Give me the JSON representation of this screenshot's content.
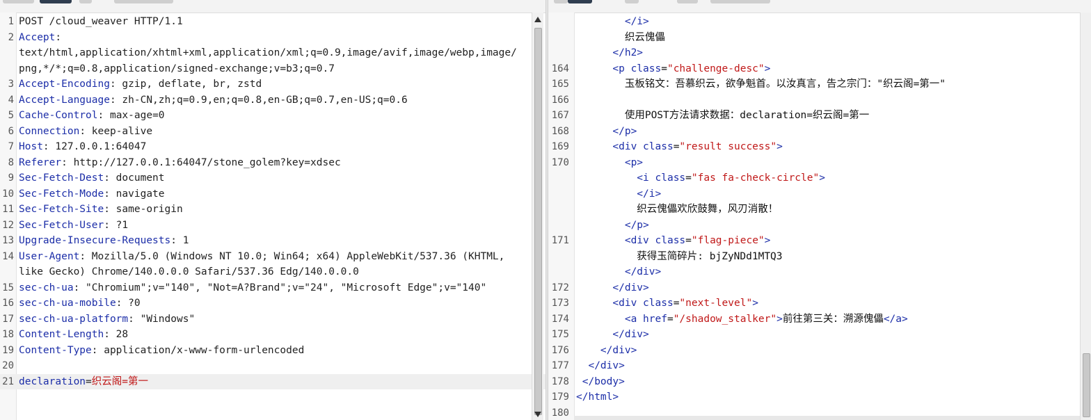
{
  "request": {
    "lines": [
      {
        "n": "1",
        "parts": [
          {
            "t": "POST /cloud_weaver HTTP/1.1",
            "c": "v"
          }
        ]
      },
      {
        "n": "2",
        "parts": [
          {
            "t": "Accept",
            "c": "k"
          },
          {
            "t": ":",
            "c": "v"
          }
        ]
      },
      {
        "n": "",
        "parts": [
          {
            "t": "text/html,application/xhtml+xml,application/xml;q=0.9,image/avif,image/webp,image/",
            "c": "v"
          }
        ]
      },
      {
        "n": "",
        "parts": [
          {
            "t": "png,*/*;q=0.8,application/signed-exchange;v=b3;q=0.7",
            "c": "v"
          }
        ]
      },
      {
        "n": "3",
        "parts": [
          {
            "t": "Accept-Encoding",
            "c": "k"
          },
          {
            "t": ": gzip, deflate, br, zstd",
            "c": "v"
          }
        ]
      },
      {
        "n": "4",
        "parts": [
          {
            "t": "Accept-Language",
            "c": "k"
          },
          {
            "t": ": zh-CN,zh;q=0.9,en;q=0.8,en-GB;q=0.7,en-US;q=0.6",
            "c": "v"
          }
        ]
      },
      {
        "n": "5",
        "parts": [
          {
            "t": "Cache-Control",
            "c": "k"
          },
          {
            "t": ": max-age=0",
            "c": "v"
          }
        ]
      },
      {
        "n": "6",
        "parts": [
          {
            "t": "Connection",
            "c": "k"
          },
          {
            "t": ": keep-alive",
            "c": "v"
          }
        ]
      },
      {
        "n": "7",
        "parts": [
          {
            "t": "Host",
            "c": "k"
          },
          {
            "t": ": 127.0.0.1:64047",
            "c": "v"
          }
        ]
      },
      {
        "n": "8",
        "parts": [
          {
            "t": "Referer",
            "c": "k"
          },
          {
            "t": ": http://127.0.0.1:64047/stone_golem?key=xdsec",
            "c": "v"
          }
        ]
      },
      {
        "n": "9",
        "parts": [
          {
            "t": "Sec-Fetch-Dest",
            "c": "k"
          },
          {
            "t": ": document",
            "c": "v"
          }
        ]
      },
      {
        "n": "10",
        "parts": [
          {
            "t": "Sec-Fetch-Mode",
            "c": "k"
          },
          {
            "t": ": navigate",
            "c": "v"
          }
        ]
      },
      {
        "n": "11",
        "parts": [
          {
            "t": "Sec-Fetch-Site",
            "c": "k"
          },
          {
            "t": ": same-origin",
            "c": "v"
          }
        ]
      },
      {
        "n": "12",
        "parts": [
          {
            "t": "Sec-Fetch-User",
            "c": "k"
          },
          {
            "t": ": ?1",
            "c": "v"
          }
        ]
      },
      {
        "n": "13",
        "parts": [
          {
            "t": "Upgrade-Insecure-Requests",
            "c": "k"
          },
          {
            "t": ": 1",
            "c": "v"
          }
        ]
      },
      {
        "n": "14",
        "parts": [
          {
            "t": "User-Agent",
            "c": "k"
          },
          {
            "t": ": Mozilla/5.0 (Windows NT 10.0; Win64; x64) AppleWebKit/537.36 (KHTML,",
            "c": "v"
          }
        ]
      },
      {
        "n": "",
        "parts": [
          {
            "t": "like Gecko) Chrome/140.0.0.0 Safari/537.36 Edg/140.0.0.0",
            "c": "v"
          }
        ]
      },
      {
        "n": "15",
        "parts": [
          {
            "t": "sec-ch-ua",
            "c": "k"
          },
          {
            "t": ": \"Chromium\";v=\"140\", \"Not=A?Brand\";v=\"24\", \"Microsoft Edge\";v=\"140\"",
            "c": "v"
          }
        ]
      },
      {
        "n": "16",
        "parts": [
          {
            "t": "sec-ch-ua-mobile",
            "c": "k"
          },
          {
            "t": ": ?0",
            "c": "v"
          }
        ]
      },
      {
        "n": "17",
        "parts": [
          {
            "t": "sec-ch-ua-platform",
            "c": "k"
          },
          {
            "t": ": \"Windows\"",
            "c": "v"
          }
        ]
      },
      {
        "n": "18",
        "parts": [
          {
            "t": "Content-Length",
            "c": "k"
          },
          {
            "t": ": 28",
            "c": "v"
          }
        ]
      },
      {
        "n": "19",
        "parts": [
          {
            "t": "Content-Type",
            "c": "k"
          },
          {
            "t": ": application/x-www-form-urlencoded",
            "c": "v"
          }
        ]
      },
      {
        "n": "20",
        "parts": []
      },
      {
        "n": "21",
        "highlight": true,
        "parts": [
          {
            "t": "declaration",
            "c": "k"
          },
          {
            "t": "=",
            "c": "v"
          },
          {
            "t": "织云阁=第一",
            "c": "body-val"
          }
        ]
      }
    ]
  },
  "response": {
    "lines": [
      {
        "n": "",
        "parts": [
          {
            "t": "        </i>",
            "c": "tag"
          }
        ]
      },
      {
        "n": "",
        "parts": [
          {
            "t": "        织云傀儡",
            "c": "txt"
          }
        ]
      },
      {
        "n": "",
        "parts": [
          {
            "t": "      </h2>",
            "c": "tag"
          }
        ]
      },
      {
        "n": "164",
        "parts": [
          {
            "t": "      <p ",
            "c": "tag"
          },
          {
            "t": "class",
            "c": "attr"
          },
          {
            "t": "=",
            "c": "txt"
          },
          {
            "t": "\"challenge-desc\"",
            "c": "str"
          },
          {
            "t": ">",
            "c": "tag"
          }
        ]
      },
      {
        "n": "165",
        "parts": [
          {
            "t": "        玉板铭文：吾慕织云，欲争魁首。以汝真言，告之宗门：\"织云阁=第一\"",
            "c": "txt"
          }
        ]
      },
      {
        "n": "166",
        "parts": []
      },
      {
        "n": "167",
        "parts": [
          {
            "t": "        使用POST方法请求数据：declaration=织云阁=第一",
            "c": "txt"
          }
        ]
      },
      {
        "n": "168",
        "parts": [
          {
            "t": "      </p>",
            "c": "tag"
          }
        ]
      },
      {
        "n": "169",
        "parts": [
          {
            "t": "      <div ",
            "c": "tag"
          },
          {
            "t": "class",
            "c": "attr"
          },
          {
            "t": "=",
            "c": "txt"
          },
          {
            "t": "\"result success\"",
            "c": "str"
          },
          {
            "t": ">",
            "c": "tag"
          }
        ]
      },
      {
        "n": "170",
        "parts": [
          {
            "t": "        <p>",
            "c": "tag"
          }
        ]
      },
      {
        "n": "",
        "parts": [
          {
            "t": "          <i ",
            "c": "tag"
          },
          {
            "t": "class",
            "c": "attr"
          },
          {
            "t": "=",
            "c": "txt"
          },
          {
            "t": "\"fas fa-check-circle\"",
            "c": "str"
          },
          {
            "t": ">",
            "c": "tag"
          }
        ]
      },
      {
        "n": "",
        "parts": [
          {
            "t": "          </i>",
            "c": "tag"
          }
        ]
      },
      {
        "n": "",
        "parts": [
          {
            "t": "          织云傀儡欢欣鼓舞，风刃消散！",
            "c": "txt"
          }
        ]
      },
      {
        "n": "",
        "parts": [
          {
            "t": "        </p>",
            "c": "tag"
          }
        ]
      },
      {
        "n": "171",
        "parts": [
          {
            "t": "        <div ",
            "c": "tag"
          },
          {
            "t": "class",
            "c": "attr"
          },
          {
            "t": "=",
            "c": "txt"
          },
          {
            "t": "\"flag-piece\"",
            "c": "str"
          },
          {
            "t": ">",
            "c": "tag"
          }
        ]
      },
      {
        "n": "",
        "parts": [
          {
            "t": "          获得玉简碎片: bjZyNDd1MTQ3",
            "c": "txt"
          }
        ]
      },
      {
        "n": "",
        "parts": [
          {
            "t": "        </div>",
            "c": "tag"
          }
        ]
      },
      {
        "n": "172",
        "parts": [
          {
            "t": "      </div>",
            "c": "tag"
          }
        ]
      },
      {
        "n": "173",
        "parts": [
          {
            "t": "      <div ",
            "c": "tag"
          },
          {
            "t": "class",
            "c": "attr"
          },
          {
            "t": "=",
            "c": "txt"
          },
          {
            "t": "\"next-level\"",
            "c": "str"
          },
          {
            "t": ">",
            "c": "tag"
          }
        ]
      },
      {
        "n": "174",
        "parts": [
          {
            "t": "        <a ",
            "c": "tag"
          },
          {
            "t": "href",
            "c": "attr"
          },
          {
            "t": "=",
            "c": "txt"
          },
          {
            "t": "\"/shadow_stalker\"",
            "c": "str"
          },
          {
            "t": ">",
            "c": "tag"
          },
          {
            "t": "前往第三关：溯源傀儡",
            "c": "txt"
          },
          {
            "t": "</a>",
            "c": "tag"
          }
        ]
      },
      {
        "n": "175",
        "parts": [
          {
            "t": "      </div>",
            "c": "tag"
          }
        ]
      },
      {
        "n": "176",
        "parts": [
          {
            "t": "    </div>",
            "c": "tag"
          }
        ]
      },
      {
        "n": "177",
        "parts": [
          {
            "t": "  </div>",
            "c": "tag"
          }
        ]
      },
      {
        "n": "178",
        "parts": [
          {
            "t": " </body>",
            "c": "tag"
          }
        ]
      },
      {
        "n": "179",
        "parts": [
          {
            "t": "</html>",
            "c": "tag"
          }
        ]
      },
      {
        "n": "180",
        "parts": []
      }
    ]
  }
}
